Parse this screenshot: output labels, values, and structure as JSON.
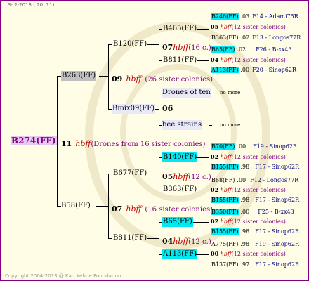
{
  "header": "3- 2-2013 ( 20: 11)",
  "footer": "Copyright 2004-2013 @ Karl Kehrle Foundation.",
  "root": {
    "name": "B274(FF)",
    "gen": "11",
    "hbff": "hbff",
    "note": "(Drones from 16 sister colonies)"
  },
  "level1": {
    "upper": {
      "name": "B263(FF)",
      "gen": "09",
      "hbff": "hbff",
      "note": "(26 sister colonies)"
    },
    "lower": {
      "name": "B58(FF)",
      "gen": "07",
      "hbff": "hbff",
      "note": "(16 sister colonies)"
    }
  },
  "level2": {
    "b120": {
      "name": "B120(FF)",
      "gen": "07",
      "hbff": "hbff",
      "note": "(16 c.)"
    },
    "bmix": {
      "name": "Bmix09(FF)",
      "gen": "06"
    },
    "b677": {
      "name": "B677(FF)",
      "gen": "05",
      "hbff": "hbff",
      "note": "(12 c.)"
    },
    "b811b": {
      "name": "B811(FF)",
      "gen": "04",
      "hbff": "hbff",
      "note": "(12 c.)"
    }
  },
  "level3": {
    "b465": {
      "name": "B465(FF)"
    },
    "b811a": {
      "name": "B811(FF)"
    },
    "drones": {
      "name": "Drones of ten"
    },
    "bee": {
      "name": "bee strains"
    },
    "b140": {
      "name": "B140(FF)"
    },
    "b363": {
      "name": "B363(FF)"
    },
    "b65": {
      "name": "B65(FF)"
    },
    "a113": {
      "name": "A113(FF)"
    }
  },
  "leaves": [
    {
      "name": "B246(FF)",
      "yr": ".03",
      "ref": "F14 - Adami75R",
      "cyan": true
    },
    {
      "gen": "05",
      "hbff": "hbff",
      "note": "(12 sister colonies)"
    },
    {
      "name": "B363(FF)",
      "yr": ".02",
      "ref": "F13 - Longos77R",
      "cyan": false
    },
    {
      "name": "B65(FF)",
      "yr": ".02",
      "ref": "F26 - B-xx43",
      "cyan": true
    },
    {
      "gen": "04",
      "hbff": "hbff",
      "note": "(12 sister colonies)"
    },
    {
      "name": "A113(FF)",
      "yr": ".00",
      "ref": "F20 - Sinop62R",
      "cyan": true
    },
    {
      "nomore": "no more"
    },
    {
      "nomore": "no more"
    },
    {
      "name": "B70(FF)",
      "yr": ".00",
      "ref": "F19 - Sinop62R",
      "cyan": true
    },
    {
      "gen": "02",
      "hbff": "hbff",
      "note": "(12 sister colonies)"
    },
    {
      "name": "B155(FF)",
      "yr": ".98",
      "ref": "F17 - Sinop62R",
      "cyan": true
    },
    {
      "name": "B68(FF)",
      "yr": ".00",
      "ref": "F12 - Longos77R",
      "cyan": false
    },
    {
      "gen": "02",
      "hbff": "hbff",
      "note": "(12 sister colonies)"
    },
    {
      "name": "B155(FF)",
      "yr": ".98",
      "ref": "F17 - Sinop62R",
      "cyan": true
    },
    {
      "name": "B350(FF)",
      "yr": ".00",
      "ref": "F25 - B-xx43",
      "cyan": true
    },
    {
      "gen": "02",
      "hbff": "hbff",
      "note": "(12 sister colonies)"
    },
    {
      "name": "B155(FF)",
      "yr": ".98",
      "ref": "F17 - Sinop62R",
      "cyan": true
    },
    {
      "name": "A775(FF)",
      "yr": ".98",
      "ref": "F19 - Sinop62R",
      "cyan": false
    },
    {
      "gen": "00",
      "hbff": "hbff",
      "note": "(12 sister colonies)"
    },
    {
      "name": "B137(FF)",
      "yr": ".97",
      "ref": "F17 - Sinop62R",
      "cyan": false
    }
  ]
}
